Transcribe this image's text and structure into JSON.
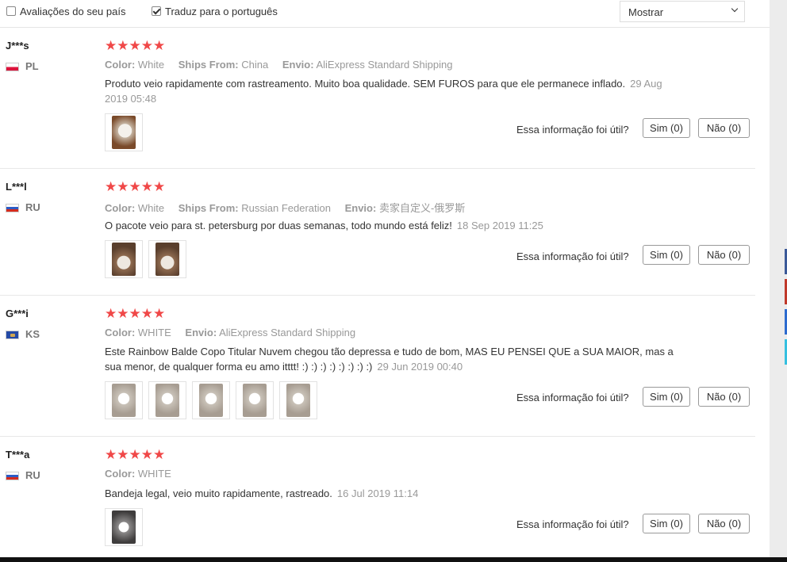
{
  "filters": {
    "country_only_label": "Avaliações do seu país",
    "country_only_checked": false,
    "translate_label": "Traduz para o português",
    "translate_checked": true,
    "show_select_value": "Mostrar"
  },
  "helpful": {
    "question": "Essa informação foi útil?"
  },
  "reviews": [
    {
      "user": "J***s",
      "country": "PL",
      "rating": 5,
      "stars": "★★★★★",
      "props": [
        {
          "label": "Color:",
          "value": "White"
        },
        {
          "label": "Ships From:",
          "value": "China"
        },
        {
          "label": "Envio:",
          "value": "AliExpress Standard Shipping"
        }
      ],
      "text": "Produto veio rapidamente com rastreamento. Muito boa qualidade. SEM FUROS para que ele permanece inflado.",
      "date": "29 Aug 2019 05:48",
      "yes_label": "Sim (0)",
      "no_label": "Não (0)"
    },
    {
      "user": "L***l",
      "country": "RU",
      "rating": 5,
      "stars": "★★★★★",
      "props": [
        {
          "label": "Color:",
          "value": "White"
        },
        {
          "label": "Ships From:",
          "value": "Russian Federation"
        },
        {
          "label": "Envio:",
          "value": "卖家自定义-俄罗斯"
        }
      ],
      "text": "O pacote veio para st. petersburg por duas semanas, todo mundo está feliz!",
      "date": "18 Sep 2019 11:25",
      "yes_label": "Sim (0)",
      "no_label": "Não (0)"
    },
    {
      "user": "G***i",
      "country": "KS",
      "rating": 5,
      "stars": "★★★★★",
      "props": [
        {
          "label": "Color:",
          "value": "WHITE"
        },
        {
          "label": "Envio:",
          "value": "AliExpress Standard Shipping"
        }
      ],
      "text": "Este Rainbow Balde Copo Titular Nuvem chegou tão depressa e tudo de bom, MAS EU PENSEI QUE a SUA MAIOR, mas a sua menor, de qualquer forma eu amo itttt! :) :) :) :) :) :) :) :)",
      "date": "29 Jun 2019 00:40",
      "yes_label": "Sim (0)",
      "no_label": "Não (0)"
    },
    {
      "user": "T***a",
      "country": "RU",
      "rating": 5,
      "stars": "★★★★★",
      "props": [
        {
          "label": "Color:",
          "value": "WHITE"
        }
      ],
      "text": "Bandeja legal, veio muito rapidamente, rastreado.",
      "date": "16 Jul 2019 11:14",
      "yes_label": "Sim (0)",
      "no_label": "Não (0)"
    }
  ],
  "side_tab_colors": [
    "#3b5998",
    "#c0392b",
    "#2d6bcf",
    "#35c0e0"
  ]
}
